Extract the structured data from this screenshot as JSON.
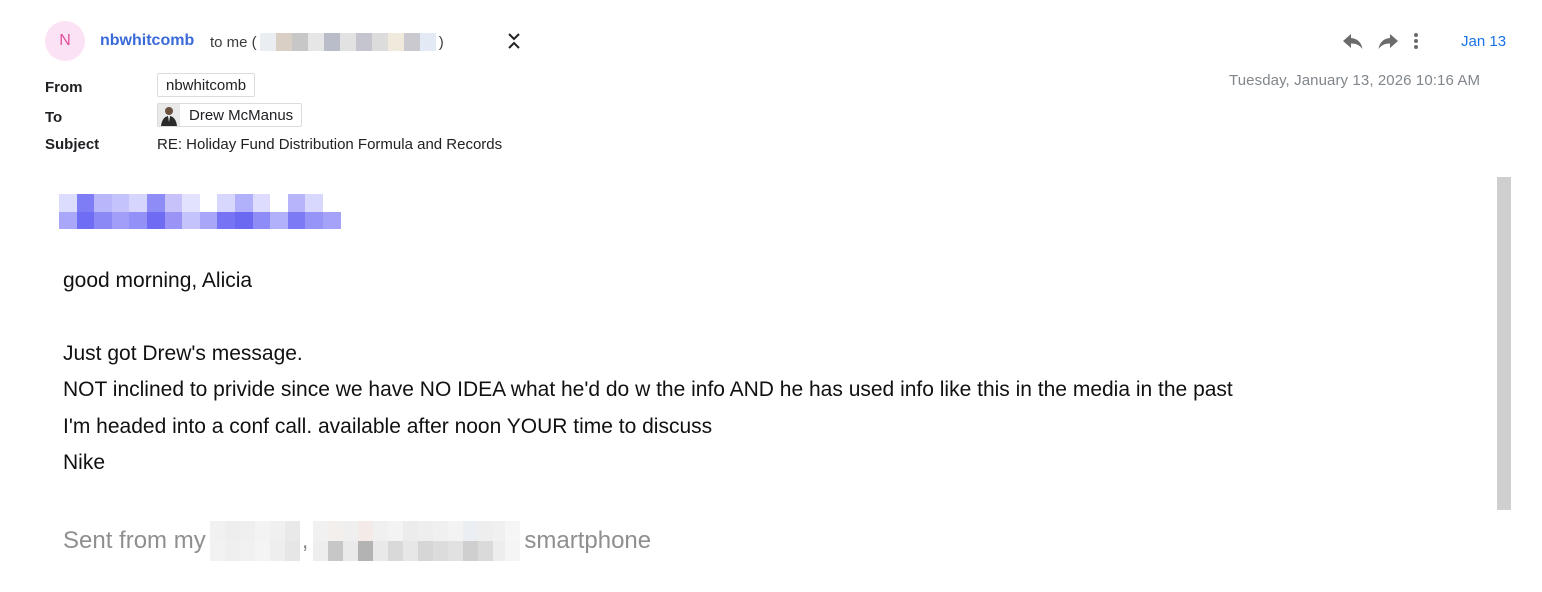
{
  "sender": {
    "avatar_letter": "N",
    "name": "nbwhitcomb",
    "to_me_prefix": "to me (",
    "to_me_suffix": ")"
  },
  "date_short": "Jan 13",
  "date_full": "Tuesday, January 13, 2026  10:16 AM",
  "headers": {
    "from_label": "From",
    "from_value": "nbwhitcomb",
    "to_label": "To",
    "to_value": "Drew McManus",
    "subject_label": "Subject",
    "subject_value": "RE: Holiday Fund Distribution Formula and Records"
  },
  "body": {
    "greeting": "good morning, Alicia",
    "lines": [
      "Just got Drew's message.",
      "NOT inclined to privide since we have NO IDEA what he'd do w the info AND he has used info like this in the media in the past",
      "I'm headed into a conf call. available after noon YOUR time to discuss",
      "Nike"
    ],
    "signature_prefix": "Sent from my",
    "signature_comma": ",",
    "signature_suffix": "smartphone"
  },
  "icons": {
    "reply": "reply-icon",
    "forward": "forward-icon",
    "more": "more-vert-icon",
    "collapse": "collapse-icon"
  },
  "colors": {
    "sender": "#3a6ad8",
    "date_link": "#1a73e8",
    "avatar_bg": "#fbe3f5",
    "avatar_fg": "#e0509c"
  }
}
